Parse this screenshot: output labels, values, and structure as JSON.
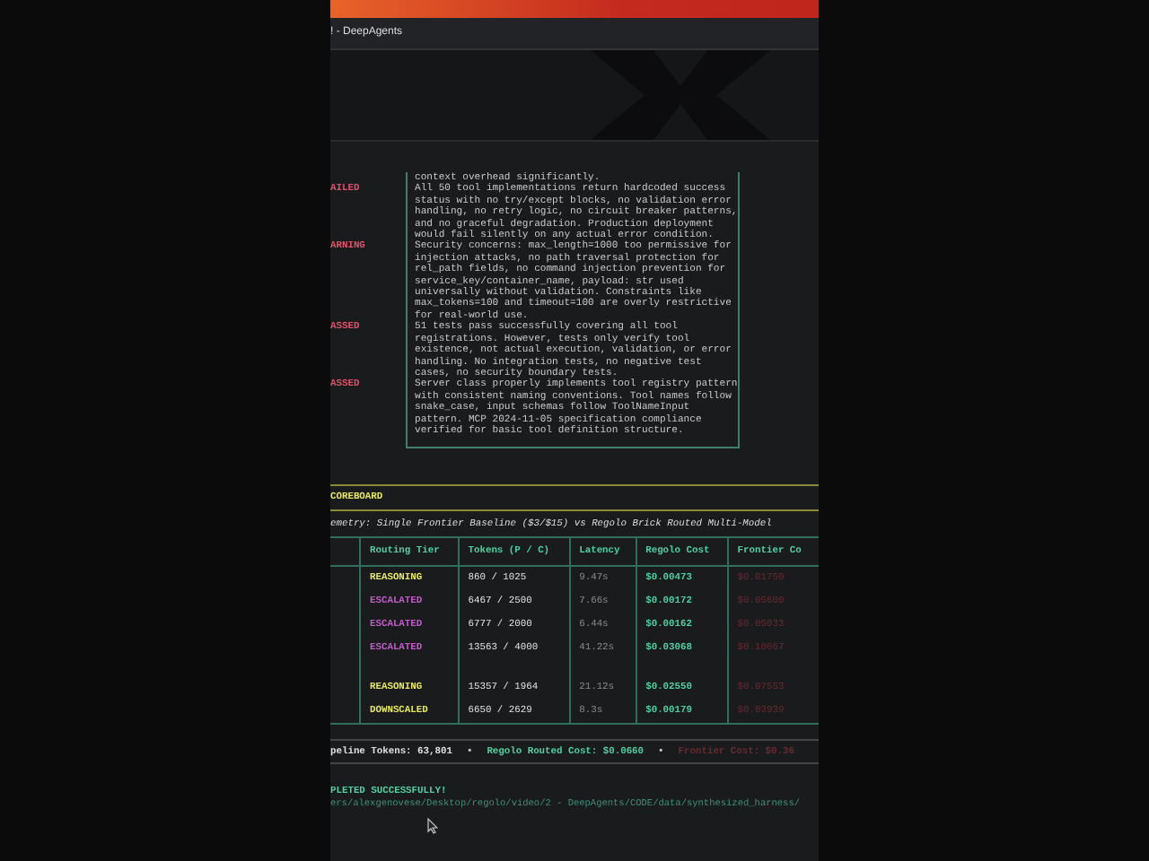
{
  "window": {
    "title": "! - DeepAgents"
  },
  "review": {
    "lead_text": "context overhead significantly.",
    "rows": [
      {
        "status": "AILED",
        "text": "All 50 tool implementations return hardcoded success\nstatus with no try/except blocks, no validation error\nhandling, no retry logic, no circuit breaker patterns,\nand no graceful degradation. Production deployment\nwould fail silently on any actual error condition."
      },
      {
        "status": "ARNING",
        "text": "Security concerns: max_length=1000 too permissive for\ninjection attacks, no path traversal protection for\nrel_path fields, no command injection prevention for\nservice_key/container_name, payload: str used\nuniversally without validation. Constraints like\nmax_tokens=100 and timeout=100 are overly restrictive\nfor real-world use."
      },
      {
        "status": "ASSED",
        "text": "51 tests pass successfully covering all tool\nregistrations. However, tests only verify tool\nexistence, not actual execution, validation, or error\nhandling. No integration tests, no negative test\ncases, no security boundary tests."
      },
      {
        "status": "ASSED",
        "text": "Server class properly implements tool registry pattern\nwith consistent naming conventions. Tool names follow\nsnake_case, input schemas follow ToolNameInput\npattern. MCP 2024-11-05 specification compliance\nverified for basic tool definition structure."
      }
    ]
  },
  "scoreboard": {
    "title": "COREBOARD",
    "subtitle": "emetry: Single Frontier Baseline ($3/$15) vs Regolo Brick Routed Multi-Model",
    "columns": [
      "Routing Tier",
      "Tokens (P / C)",
      "Latency",
      "Regolo Cost",
      "Frontier Co"
    ],
    "rows": [
      {
        "tier": "REASONING",
        "color": "#e6e65a",
        "tokens": "860 / 1025",
        "latency": "9.47s",
        "regolo": "$0.00473",
        "frontier": "$0.01750"
      },
      {
        "tier": "ESCALATED",
        "color": "#c05ac8",
        "tokens": "6467 / 2500",
        "latency": "7.66s",
        "regolo": "$0.00172",
        "frontier": "$0.05600"
      },
      {
        "tier": "ESCALATED",
        "color": "#c05ac8",
        "tokens": "6777 / 2000",
        "latency": "6.44s",
        "regolo": "$0.00162",
        "frontier": "$0.05033"
      },
      {
        "tier": "ESCALATED",
        "color": "#c05ac8",
        "tokens": "13563 / 4000",
        "latency": "41.22s",
        "regolo": "$0.03068",
        "frontier": "$0.10067"
      },
      {
        "tier": "REASONING",
        "color": "#e6e65a",
        "tokens": "15357 / 1964",
        "latency": "21.12s",
        "regolo": "$0.02550",
        "frontier": "$0.07553"
      },
      {
        "tier": "DOWNSCALED",
        "color": "#e6e65a",
        "tokens": "6650 / 2629",
        "latency": "8.3s",
        "regolo": "$0.00179",
        "frontier": "$0.03939"
      }
    ],
    "totals": [
      "peline Tokens: 63,801",
      "•",
      "Regolo Routed Cost: $0.0660",
      "•",
      "Frontier Cost: $0.36"
    ]
  },
  "completion": "PLETED SUCCESSFULLY!",
  "path": "ers/alexgenovese/Desktop/regolo/video/2 - DeepAgents/CODE/data/synthesized_harness/"
}
